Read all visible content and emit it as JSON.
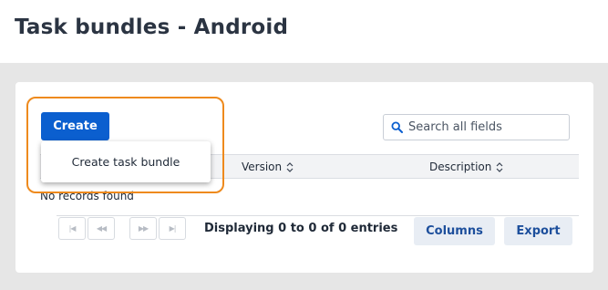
{
  "page": {
    "title": "Task bundles - Android"
  },
  "toolbar": {
    "create_label": "Create",
    "create_menu": {
      "items": [
        {
          "label": "Create task bundle"
        }
      ]
    }
  },
  "search": {
    "placeholder": "Search all fields",
    "value": "",
    "icon": "search-icon"
  },
  "table": {
    "columns": [
      {
        "label": "Version",
        "sortable": true
      },
      {
        "label": "Description",
        "sortable": true
      }
    ],
    "empty_message": "No records found"
  },
  "pagination": {
    "first_label": "|◀",
    "prev_label": "◀◀",
    "next_label": "▶▶",
    "last_label": "▶|",
    "info": "Displaying 0 to 0 of 0 entries"
  },
  "footer_actions": {
    "columns_label": "Columns",
    "export_label": "Export"
  },
  "colors": {
    "primary": "#0b5fcf",
    "focus_outline": "#ee8a1d",
    "background": "#e6e6e6",
    "secondary_button_bg": "#e8edf4",
    "secondary_button_text": "#1d4f9c"
  }
}
